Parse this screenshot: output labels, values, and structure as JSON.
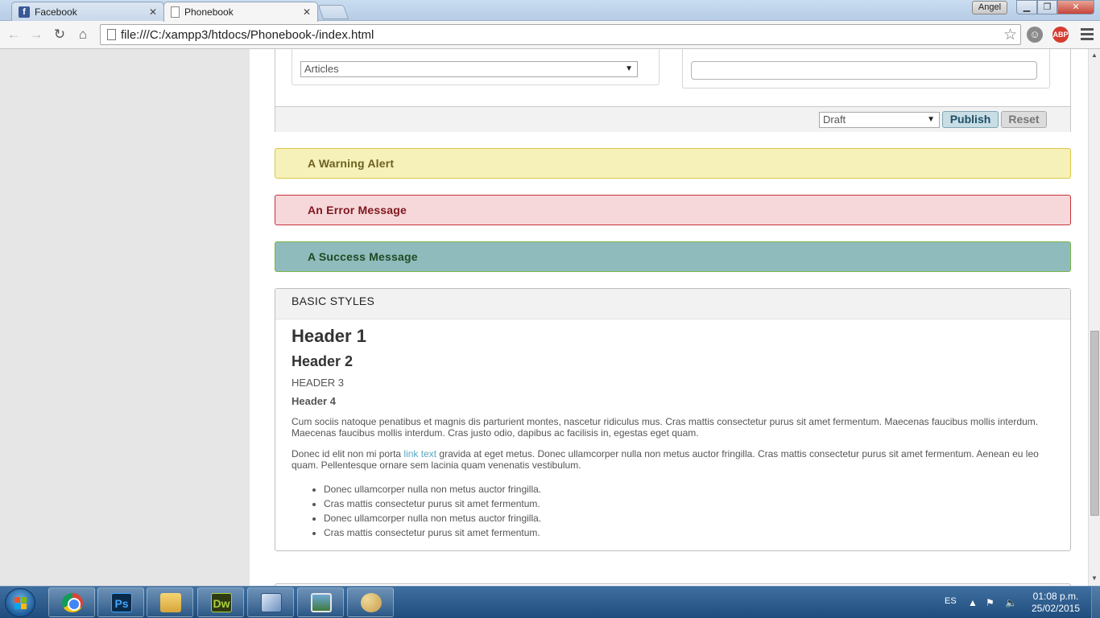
{
  "browser": {
    "tabs": [
      {
        "title": "Facebook",
        "favicon": "facebook-icon"
      },
      {
        "title": "Phonebook",
        "favicon": "document-icon"
      }
    ],
    "profile_name": "Angel",
    "url": "file:///C:/xampp3/htdocs/Phonebook-/index.html",
    "extensions": [
      "ghostery-icon",
      "adblock-plus-icon"
    ],
    "abp_label": "ABP"
  },
  "form": {
    "category_select": "Articles",
    "status_select": "Draft",
    "publish_label": "Publish",
    "reset_label": "Reset"
  },
  "alerts": {
    "warning": "A Warning Alert",
    "error": "An Error Message",
    "success": "A Success Message"
  },
  "basic_styles": {
    "title": "BASIC STYLES",
    "header1": "Header 1",
    "header2": "Header 2",
    "header3": "HEADER 3",
    "header4": "Header 4",
    "paragraph1": "Cum sociis natoque penatibus et magnis dis parturient montes, nascetur ridiculus mus. Cras mattis consectetur purus sit amet fermentum. Maecenas faucibus mollis interdum. Maecenas faucibus mollis interdum. Cras justo odio, dapibus ac facilisis in, egestas eget quam.",
    "paragraph2_before": "Donec id elit non mi porta ",
    "paragraph2_link": "link text",
    "paragraph2_after": " gravida at eget metus. Donec ullamcorper nulla non metus auctor fringilla. Cras mattis consectetur purus sit amet fermentum. Aenean eu leo quam. Pellentesque ornare sem lacinia quam venenatis vestibulum.",
    "list": [
      "Donec ullamcorper nulla non metus auctor fringilla.",
      "Cras mattis consectetur purus sit amet fermentum.",
      "Donec ullamcorper nulla non metus auctor fringilla.",
      "Cras mattis consectetur purus sit amet fermentum."
    ]
  },
  "taskbar": {
    "apps": [
      "chrome-icon",
      "photoshop-icon",
      "file-explorer-icon",
      "dreamweaver-icon",
      "3d-box-icon",
      "photo-viewer-icon",
      "paint-icon"
    ],
    "ps_label": "Ps",
    "dw_label": "Dw",
    "language": "ES",
    "time": "01:08 p.m.",
    "date": "25/02/2015"
  },
  "colors": {
    "warning_bg": "#f6f1b8",
    "error_bg": "#f6d8da",
    "success_bg": "#90bbbd",
    "link": "#5aa6c4"
  }
}
